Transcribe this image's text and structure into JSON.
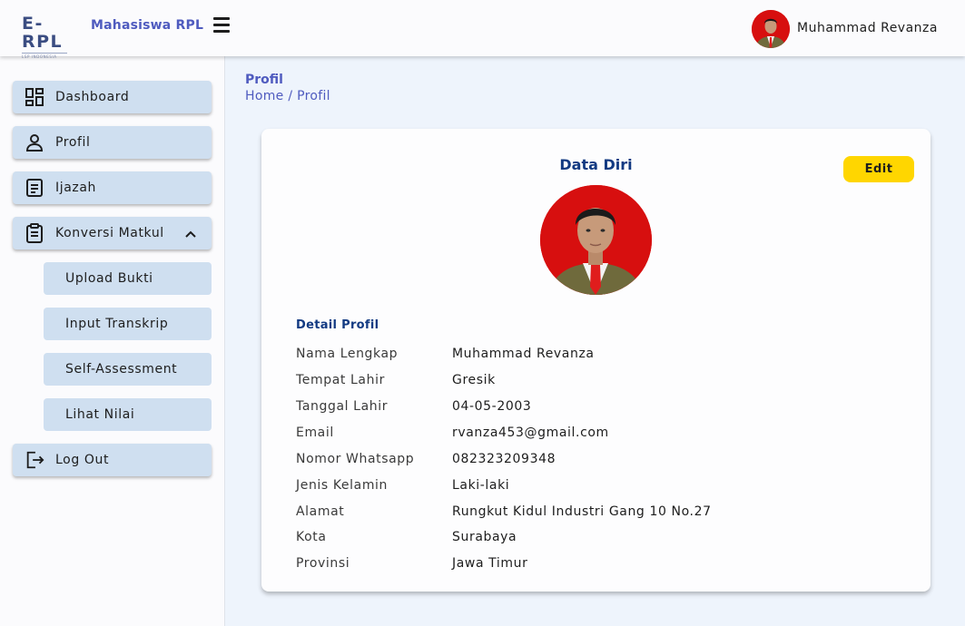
{
  "header": {
    "logo_text": "E-RPL",
    "logo_subtext": "LSP INDONESIA",
    "app_name": "Mahasiswa RPL",
    "user_name": "Muhammad Revanza"
  },
  "sidebar": {
    "items": [
      {
        "label": "Dashboard",
        "icon": "dashboard-icon"
      },
      {
        "label": "Profil",
        "icon": "user-icon"
      },
      {
        "label": "Ijazah",
        "icon": "document-icon"
      },
      {
        "label": "Konversi Matkul",
        "icon": "clipboard-icon",
        "expanded": true
      },
      {
        "label": "Log Out",
        "icon": "logout-icon"
      }
    ],
    "subitems": [
      {
        "label": "Upload Bukti"
      },
      {
        "label": "Input Transkrip"
      },
      {
        "label": "Self-Assessment"
      },
      {
        "label": "Lihat Nilai"
      }
    ]
  },
  "page": {
    "heading": "Profil",
    "breadcrumb_home": "Home",
    "breadcrumb_sep": "/",
    "breadcrumb_current": "Profil"
  },
  "card": {
    "title": "Data Diri",
    "edit_label": "Edit",
    "detail_heading": "Detail Profil",
    "fields": [
      {
        "label": "Nama Lengkap",
        "value": "Muhammad Revanza"
      },
      {
        "label": "Tempat Lahir",
        "value": "Gresik"
      },
      {
        "label": "Tanggal Lahir",
        "value": "04-05-2003"
      },
      {
        "label": "Email",
        "value": "rvanza453@gmail.com"
      },
      {
        "label": "Nomor Whatsapp",
        "value": "082323209348"
      },
      {
        "label": "Jenis Kelamin",
        "value": "Laki-laki"
      },
      {
        "label": "Alamat",
        "value": "Rungkut Kidul Industri Gang 10 No.27"
      },
      {
        "label": "Kota",
        "value": "Surabaya"
      },
      {
        "label": "Provinsi",
        "value": "Jawa Timur"
      }
    ]
  },
  "colors": {
    "accent": "#4f5bbf",
    "title": "#123a82",
    "nav_bg": "#cfdff0",
    "edit_button": "#ffd600",
    "photo_bg": "#d70f0f"
  }
}
